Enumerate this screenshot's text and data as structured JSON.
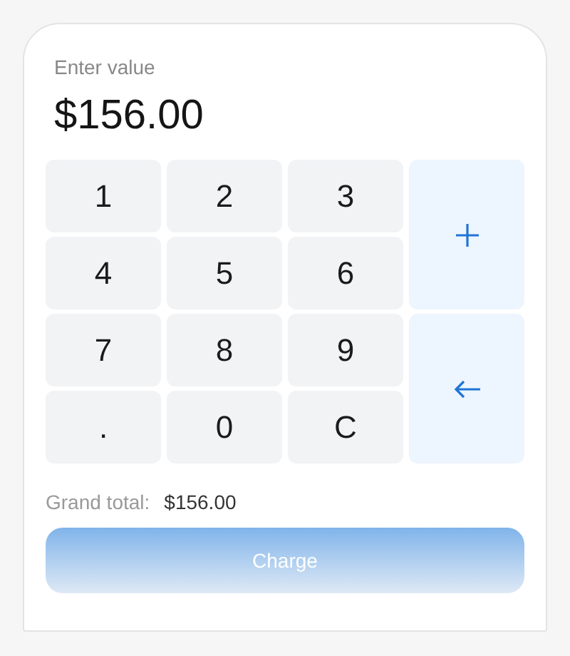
{
  "display": {
    "label": "Enter value",
    "value": "$156.00"
  },
  "keypad": {
    "keys": [
      {
        "label": "1"
      },
      {
        "label": "2"
      },
      {
        "label": "3"
      },
      {
        "label": "4"
      },
      {
        "label": "5"
      },
      {
        "label": "6"
      },
      {
        "label": "7"
      },
      {
        "label": "8"
      },
      {
        "label": "9"
      },
      {
        "label": "."
      },
      {
        "label": "0"
      },
      {
        "label": "C"
      }
    ],
    "actions": [
      {
        "kind": "add"
      },
      {
        "kind": "backspace"
      }
    ]
  },
  "total": {
    "label": "Grand total:",
    "value": "$156.00"
  },
  "charge_button": {
    "label": "Charge",
    "disabled": true
  }
}
